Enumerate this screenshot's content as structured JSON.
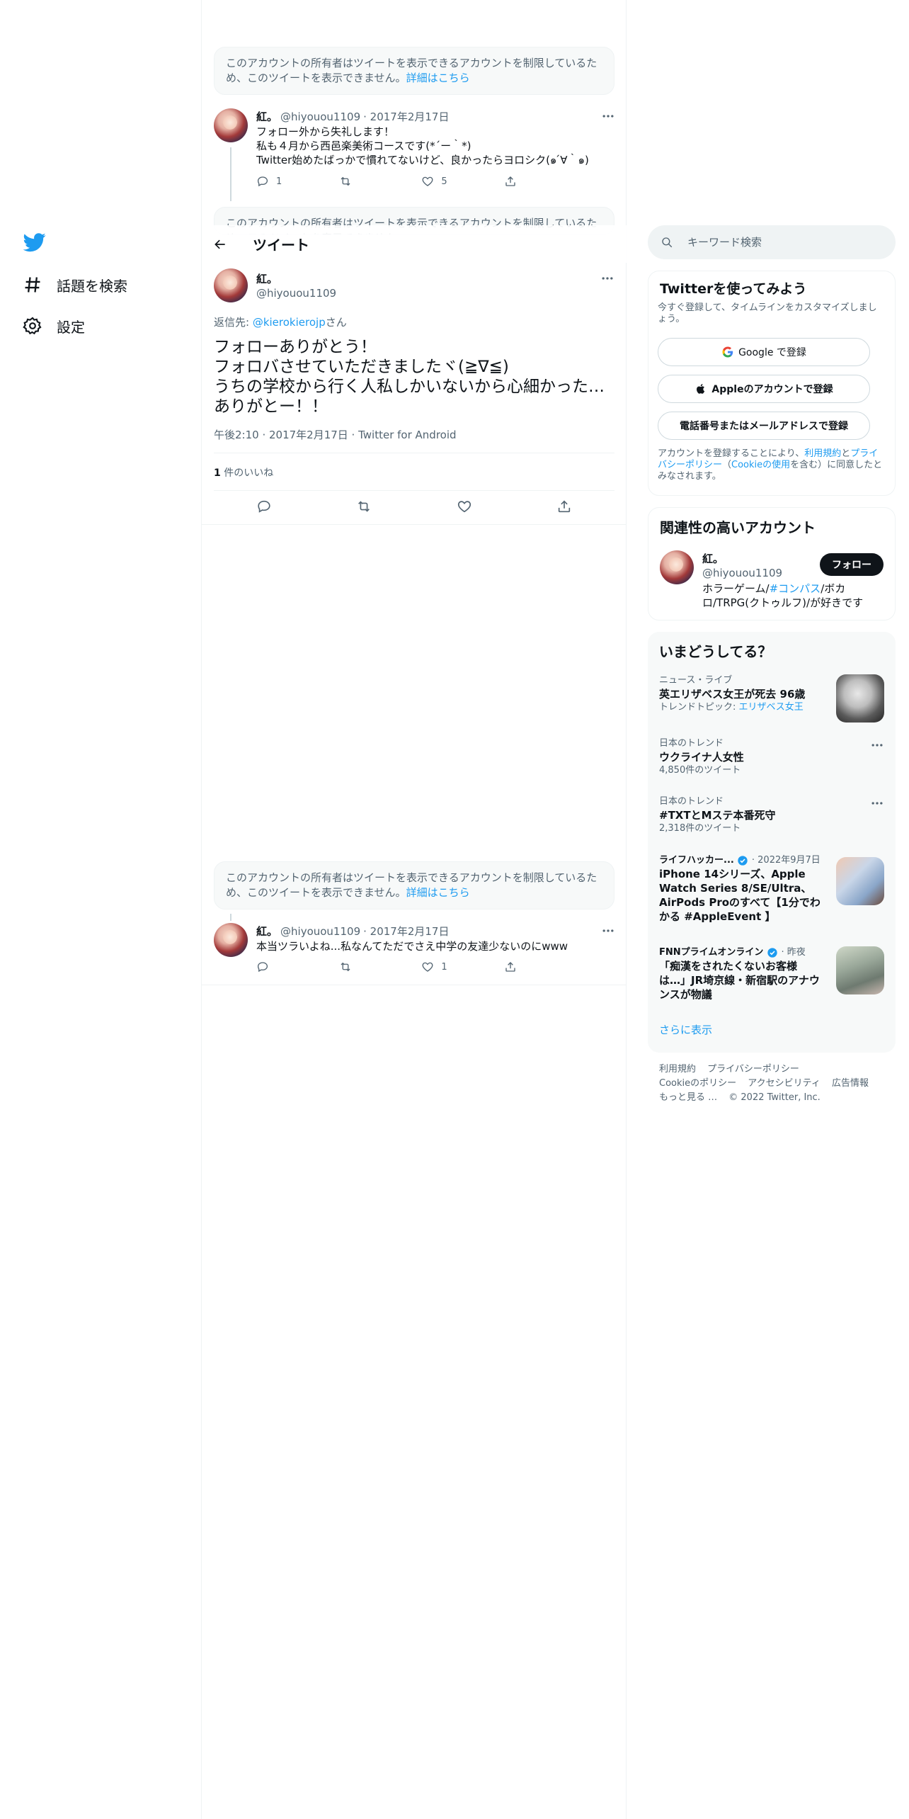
{
  "nav": {
    "explore_label": "話題を検索",
    "settings_label": "設定"
  },
  "header": {
    "title": "ツイート"
  },
  "notice": {
    "text": "このアカウントの所有者はツイートを表示できるアカウントを制限しているため、このツイートを表示できません。",
    "link": "詳細はこちら"
  },
  "tweets": [
    {
      "name": "紅。",
      "handle": "@hiyouou1109",
      "date": "· 2017年2月17日",
      "lines": [
        "フォロー外から失礼します！",
        "私も４月から西邑楽美術コースです(*´ー｀*)",
        "Twitter始めたばっかで慣れてないけど、良かったらヨロシク(๑ ́∀｀๑)"
      ],
      "reply_count": "1",
      "like_count": "5"
    },
    {
      "name": "紅。",
      "handle": "@hiyouou1109",
      "date": "· 2017年2月17日",
      "lines": [
        "本当ツラいよね...私なんてただでさえ中学の友達少ないのにwww"
      ],
      "like_count": "1"
    }
  ],
  "main_tweet": {
    "name": "紅。",
    "handle": "@hiyouou1109",
    "reply_to_prefix": "返信先: ",
    "reply_to_handle": "@kierokierojp",
    "reply_to_suffix": "さん",
    "lines": [
      "フォローありがとう！",
      "フォロバさせていただきましたヾ(≧∇≦)",
      "うちの学校から行く人私しかいないから心細かった…",
      "ありがとー！！"
    ],
    "meta": "午後2:10 · 2017年2月17日 · Twitter for Android",
    "like_count": "1",
    "like_label": "件のいいね"
  },
  "search": {
    "placeholder": "キーワード検索"
  },
  "signup": {
    "title": "Twitterを使ってみよう",
    "subtitle": "今すぐ登録して、タイムラインをカスタマイズしましょう。",
    "google_label": "Google で登録",
    "apple_label": "Appleのアカウントで登録",
    "phone_label": "電話番号またはメールアドレスで登録",
    "legal_prefix": "アカウントを登録することにより、",
    "legal_terms": "利用規約",
    "legal_and": "と",
    "legal_privacy": "プライバシーポリシー",
    "legal_cookie_open": "（",
    "legal_cookie": "Cookieの使用",
    "legal_suffix": "を含む）に同意したとみなされます。"
  },
  "related": {
    "title": "関連性の高いアカウント",
    "name": "紅。",
    "handle": "@hiyouou1109",
    "follow_label": "フォロー",
    "bio_prefix": "ホラーゲーム/",
    "bio_link": "#コンパス",
    "bio_suffix": "/ボカロ/TRPG(クトゥルフ)/が好きです"
  },
  "trends": {
    "title": "いまどうしてる？",
    "items": [
      {
        "category": "ニュース・ライブ",
        "name": "英エリザベス女王が死去 96歳",
        "sub_prefix": "トレンドトピック: ",
        "sub_link": "エリザベス女王"
      },
      {
        "category": "日本のトレンド",
        "name": "ウクライナ人女性",
        "sub": "4,850件のツイート"
      },
      {
        "category": "日本のトレンド",
        "name": "#TXTとMステ本番死守",
        "sub": "2,318件のツイート"
      },
      {
        "source": "ライフハッカー...",
        "time": "· 2022年9月7日",
        "name": "iPhone 14シリーズ、Apple Watch Series 8/SE/Ultra、AirPods Proのすべて【1分でわかる #AppleEvent 】"
      },
      {
        "source": "FNNプライムオンライン",
        "time": "· 昨夜",
        "name": "「痴漢をされたくないお客様は…」JR埼京線・新宿駅のアナウンスが物議"
      }
    ],
    "show_more": "さらに表示"
  },
  "footer": {
    "links": [
      "利用規約",
      "プライバシーポリシー",
      "Cookieのポリシー",
      "アクセシビリティ",
      "広告情報",
      "もっと見る …",
      "© 2022 Twitter, Inc."
    ]
  },
  "colors": {
    "accent": "#1d9bf0",
    "text": "#0f1419",
    "muted": "#536471"
  }
}
